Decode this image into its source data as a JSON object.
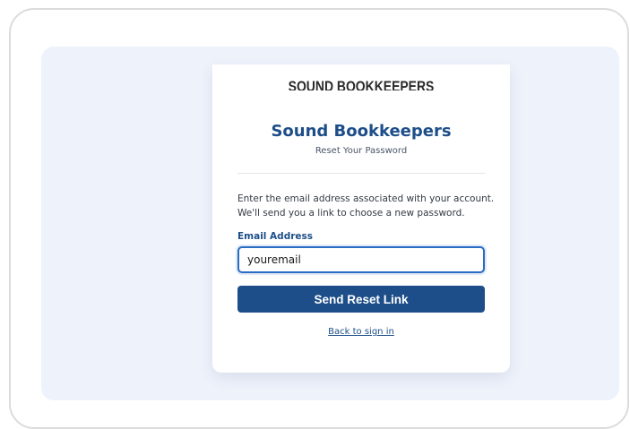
{
  "card": {
    "logo_text": "SOUND BOOKKEEPERS",
    "title": "Sound Bookkeepers",
    "subtitle": "Reset Your Password",
    "description_line1": "Enter the email address associated with your account.",
    "description_line2": "We'll send you a link to choose a new password.",
    "email_label": "Email Address",
    "email_value": "youremail",
    "submit_label": "Send Reset Link",
    "back_link": "Back to sign in"
  },
  "colors": {
    "brand": "#1d4e89",
    "panel_bg": "#eef2fb",
    "input_focus": "#2c6bc4"
  }
}
